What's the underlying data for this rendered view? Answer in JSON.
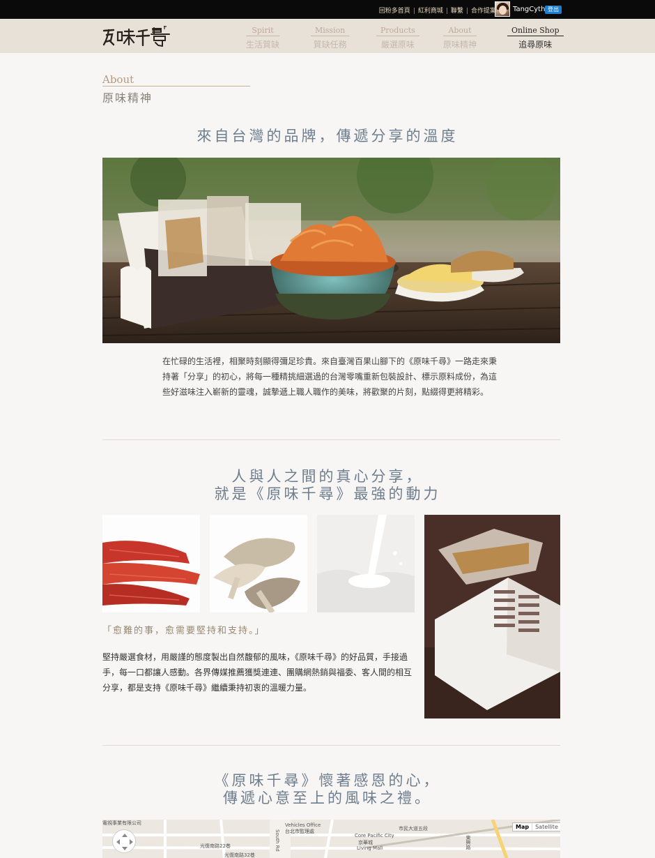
{
  "topbar": {
    "links": [
      "回粉多首頁",
      "紅利商城",
      "聯繫",
      "合作提案"
    ],
    "username": "TangCyth",
    "logout_label": "登出"
  },
  "nav": {
    "logo_alt": "原味千尋",
    "items": [
      {
        "en": "Spirit",
        "zh": "生活質缺",
        "active": false
      },
      {
        "en": "Mission",
        "zh": "質缺任務",
        "active": false
      },
      {
        "en": "Products",
        "zh": "嚴選原味",
        "active": false
      },
      {
        "en": "About",
        "zh": "原味精神",
        "active": false
      },
      {
        "en": "Online Shop",
        "zh": "追尋原味",
        "active": true
      }
    ]
  },
  "about": {
    "title_en": "About",
    "title_zh": "原味精神"
  },
  "section1": {
    "headline": "來自台灣的品牌，傳遞分享的溫度",
    "paragraph": "在忙碌的生活裡，相聚時刻顯得彌足珍貴。來自臺灣百果山腳下的《原味千尋》一路走來秉持著「分享」的初心，將每一種精挑細選過的台灣零嘴重新包裝設計、標示原料成份，為這些好滋味注入嶄新的靈魂，誠摯遞上職人職作的美味，將歡聚的片刻，點綴得更將精彩。"
  },
  "section2": {
    "headline_line1": "人與人之間的真心分享，",
    "headline_line2": "就是《原味千尋》最強的動力",
    "quote": "「愈難的事，愈需要堅持和支持。」",
    "paragraph": "堅持嚴選食材，用嚴謹的態度製出自然馥郁的風味，《原味千尋》的好品質，手接過手，每一口都讓人感動。各界傳媒推薦獲獎連連、團購網熱銷與福委、客人間的相互分享，都是支持《原味千尋》繼續秉持初衷的溫暖力量。"
  },
  "section3": {
    "headline_line1": "《原味千尋》懷著感恩的心，",
    "headline_line2": "傳遞心意至上的風味之禮。"
  },
  "map": {
    "map_label": "Map",
    "satellite_label": "Satellite",
    "labels": [
      "電視事業有限公司",
      "光復南路22巷",
      "光復南路32巷",
      "Vehicles Office",
      "台北市監理處",
      "Core Pacific City",
      "京華城",
      "Living Mall",
      "South Rd",
      "市民大道五段",
      "東興路"
    ]
  },
  "colors": {
    "topbar_bg": "#0a0a0a",
    "navbar_bg": "#e8e1d8",
    "headline": "#6e7e8e",
    "accent_link": "#e6d7b8",
    "logout_bg": "#1d7fd1"
  }
}
